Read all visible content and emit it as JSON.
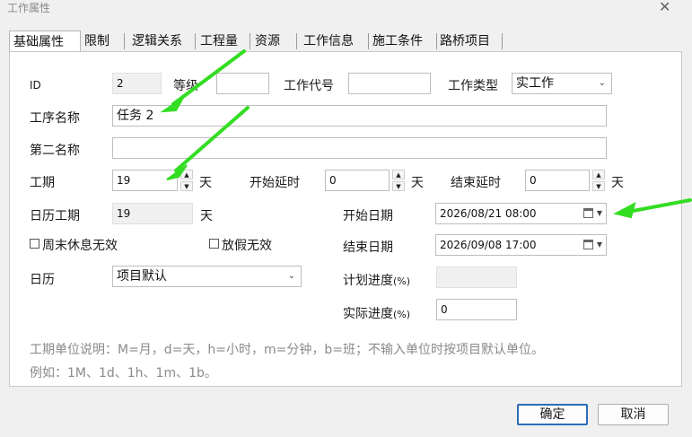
{
  "window": {
    "title": "工作属性",
    "close_glyph": "✕"
  },
  "tabs": [
    {
      "label": "基础属性",
      "active": true
    },
    {
      "label": "限制"
    },
    {
      "label": "逻辑关系"
    },
    {
      "label": "工程量"
    },
    {
      "label": "资源"
    },
    {
      "label": "工作信息"
    },
    {
      "label": "施工条件"
    },
    {
      "label": "路桥项目"
    }
  ],
  "form": {
    "id_label": "ID",
    "id_value": "2",
    "grade_label": "等级",
    "grade_value": "",
    "code_label": "工作代号",
    "code_value": "",
    "type_label": "工作类型",
    "type_value": "实工作",
    "name_label": "工序名称",
    "name_value": "任务 2",
    "second_name_label": "第二名称",
    "second_name_value": "",
    "duration_label": "工期",
    "duration_value": "19",
    "duration_unit": "天",
    "start_delay_label": "开始延时",
    "start_delay_value": "0",
    "start_delay_unit": "天",
    "end_delay_label": "结束延时",
    "end_delay_value": "0",
    "end_delay_unit": "天",
    "calendar_duration_label": "日历工期",
    "calendar_duration_value": "19",
    "calendar_duration_unit": "天",
    "start_date_label": "开始日期",
    "start_date_value": "2026/08/21 08:00",
    "end_date_label": "结束日期",
    "end_date_value": "2026/09/08 17:00",
    "weekend_invalid_label": "周末休息无效",
    "holiday_invalid_label": "放假无效",
    "calendar_label": "日历",
    "calendar_value": "项目默认",
    "planned_progress_label": "计划进度",
    "planned_progress_unit": "(%)",
    "planned_progress_value": "",
    "actual_progress_label": "实际进度",
    "actual_progress_unit": "(%)",
    "actual_progress_value": "0"
  },
  "notes": {
    "line1": "工期单位说明：M=月，d=天，h=小时，m=分钟，b=班；不输入单位时按项目默认单位。",
    "line2": "例如：1M、1d、1h、1m、1b。"
  },
  "buttons": {
    "ok": "确定",
    "cancel": "取消"
  },
  "colors": {
    "annotation_arrow": "#33dd22",
    "primary_border": "#2d6db5"
  }
}
